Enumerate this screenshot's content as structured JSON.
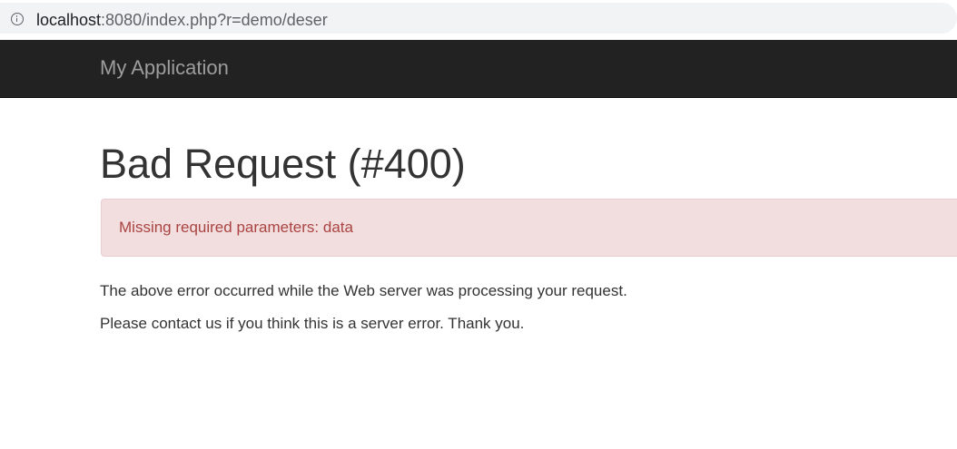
{
  "browser": {
    "url_host": "localhost",
    "url_rest": ":8080/index.php?r=demo/deser",
    "info_icon": "info-icon"
  },
  "navbar": {
    "brand": "My Application"
  },
  "error": {
    "title": "Bad Request (#400)",
    "message": "Missing required parameters: data",
    "paragraphs": [
      "The above error occurred while the Web server was processing your request.",
      "Please contact us if you think this is a server error. Thank you."
    ]
  },
  "colors": {
    "navbar_bg": "#222222",
    "brand_text": "#9d9d9d",
    "alert_bg": "#f2dede",
    "alert_text": "#a94442",
    "body_text": "#333333"
  }
}
